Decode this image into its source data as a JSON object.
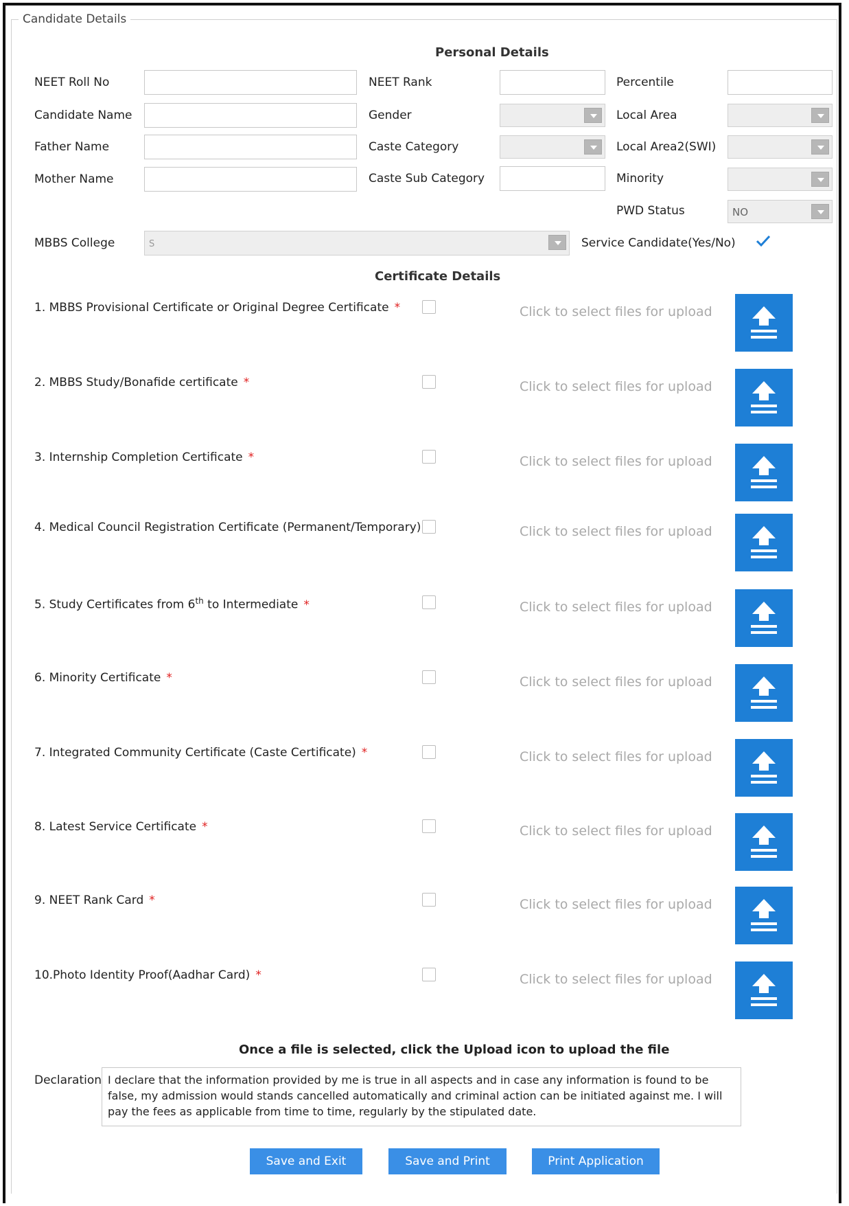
{
  "panel": {
    "legend": "Candidate Details"
  },
  "personal": {
    "heading": "Personal Details",
    "neet_roll_no_label": "NEET Roll No",
    "neet_rank_label": "NEET Rank",
    "percentile_label": "Percentile",
    "candidate_name_label": "Candidate Name",
    "gender_label": "Gender",
    "local_area_label": "Local Area",
    "father_name_label": "Father Name",
    "caste_category_label": "Caste Category",
    "local_area2_label": "Local Area2(SWI)",
    "mother_name_label": "Mother Name",
    "caste_sub_category_label": "Caste Sub Category",
    "minority_label": "Minority",
    "pwd_status_label": "PWD Status",
    "pwd_status_value": "NO",
    "mbbs_college_label": "MBBS College",
    "mbbs_college_value": "S",
    "service_candidate_label": "Service Candidate(Yes/No)",
    "service_candidate_checked": true
  },
  "certificates": {
    "heading": "Certificate Details",
    "upload_hint": "Click to select files for upload",
    "items": [
      {
        "label": "1. MBBS Provisional Certificate or Original Degree Certificate",
        "required": "*"
      },
      {
        "label": "2. MBBS Study/Bonafide certificate",
        "required": "*"
      },
      {
        "label": "3. Internship Completion Certificate",
        "required": "*"
      },
      {
        "label": "4. Medical Council Registration Certificate (Permanent/Temporary)",
        "required": "*"
      },
      {
        "label_prefix": "5. Study Certificates from 6",
        "label_sup": "th",
        "label_suffix": " to Intermediate",
        "required": "*"
      },
      {
        "label": "6. Minority Certificate",
        "required": "*"
      },
      {
        "label": "7. Integrated Community Certificate (Caste Certificate)",
        "required": "*"
      },
      {
        "label": "8. Latest Service Certificate",
        "required": "*"
      },
      {
        "label": "9. NEET Rank Card",
        "required": "*"
      },
      {
        "label": "10.Photo Identity Proof(Aadhar Card)",
        "required": "*"
      }
    ]
  },
  "footer": {
    "upload_note": "Once a file is selected, click the Upload icon to upload the file",
    "declaration_label": "Declaration",
    "declaration_text": "I declare that the information provided by me is true in all aspects and in case any information is found to be false, my admission would stands cancelled automatically and criminal action can be initiated against me. I will pay the fees as applicable from time to time, regularly by the stipulated date.",
    "save_exit_label": "Save and Exit",
    "save_print_label": "Save and Print",
    "print_application_label": "Print Application"
  },
  "colors": {
    "upload_button": "#1e7fd6",
    "action_button": "#3a8fe6",
    "required": "#e02020",
    "check": "#1e7fd6"
  }
}
